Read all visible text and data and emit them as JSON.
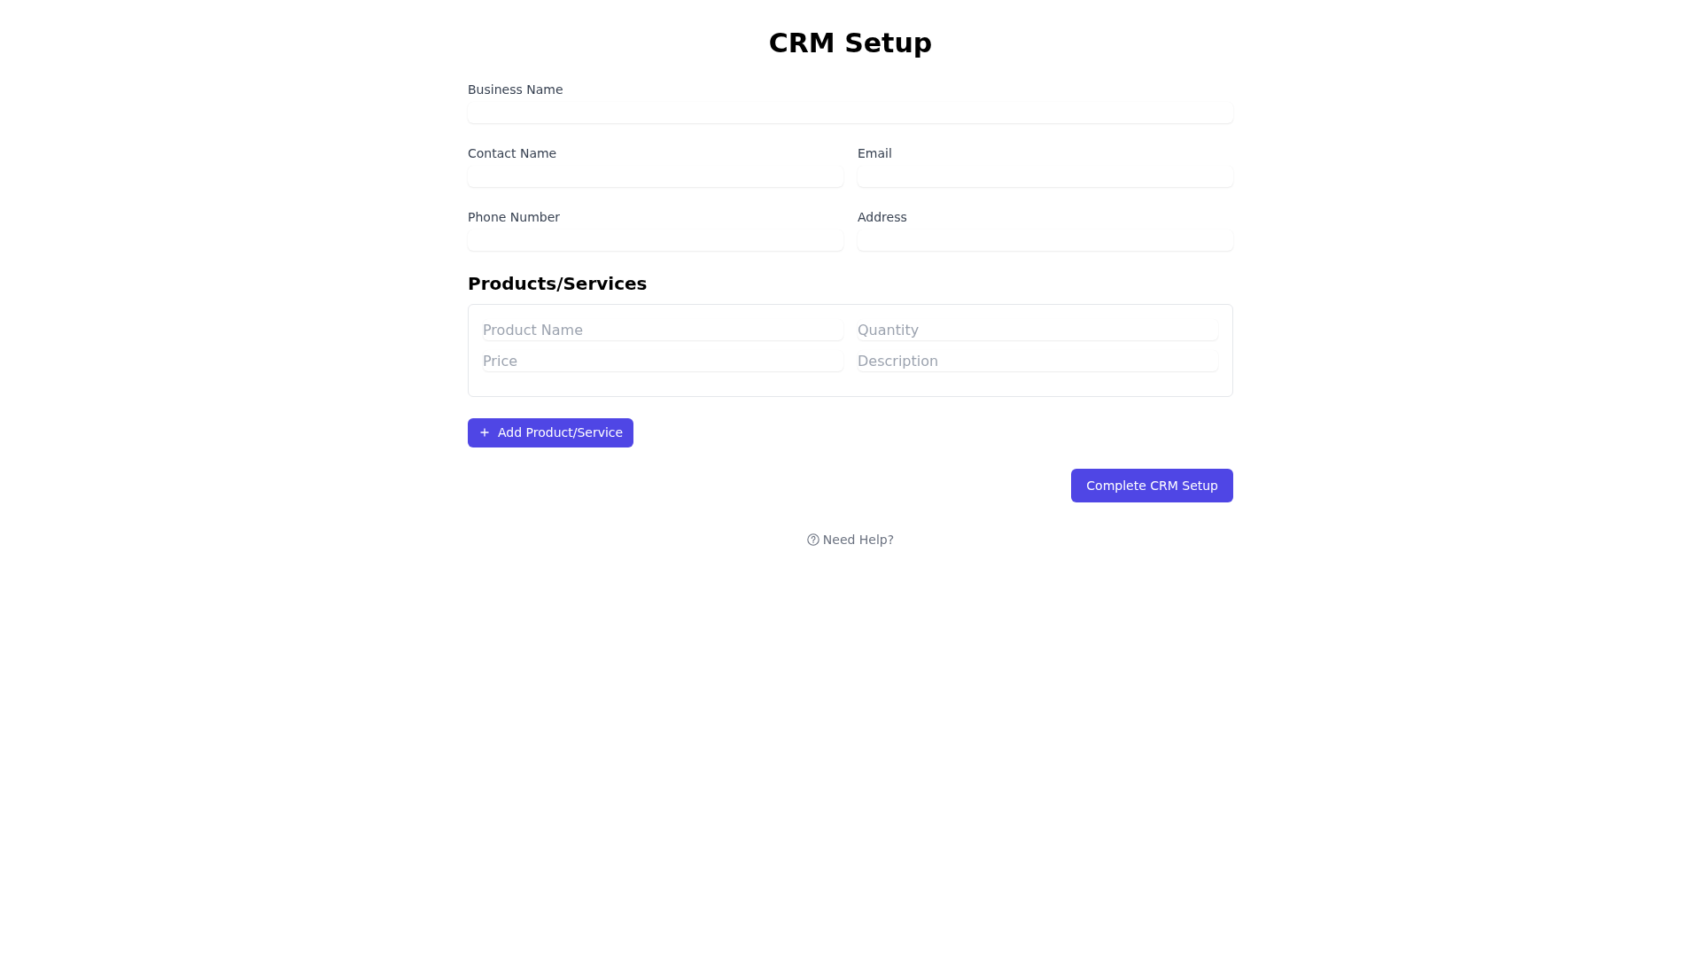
{
  "title": "CRM Setup",
  "business_info": {
    "rows": [
      {
        "fields": [
          {
            "label": "Business Name"
          }
        ]
      },
      {
        "fields": [
          {
            "label": "Contact Name"
          },
          {
            "label": "Email"
          }
        ]
      },
      {
        "fields": [
          {
            "label": "Phone Number"
          },
          {
            "label": "Address"
          }
        ]
      }
    ]
  },
  "products": {
    "title": "Products/Services",
    "items": [
      {
        "fields": [
          {
            "placeholder": "Product Name"
          },
          {
            "placeholder": "Quantity"
          },
          {
            "placeholder": "Price"
          },
          {
            "placeholder": "Description"
          }
        ]
      }
    ],
    "add_button": "Add Product/Service"
  },
  "submit_button": "Complete CRM Setup",
  "help_link": "Need Help?"
}
